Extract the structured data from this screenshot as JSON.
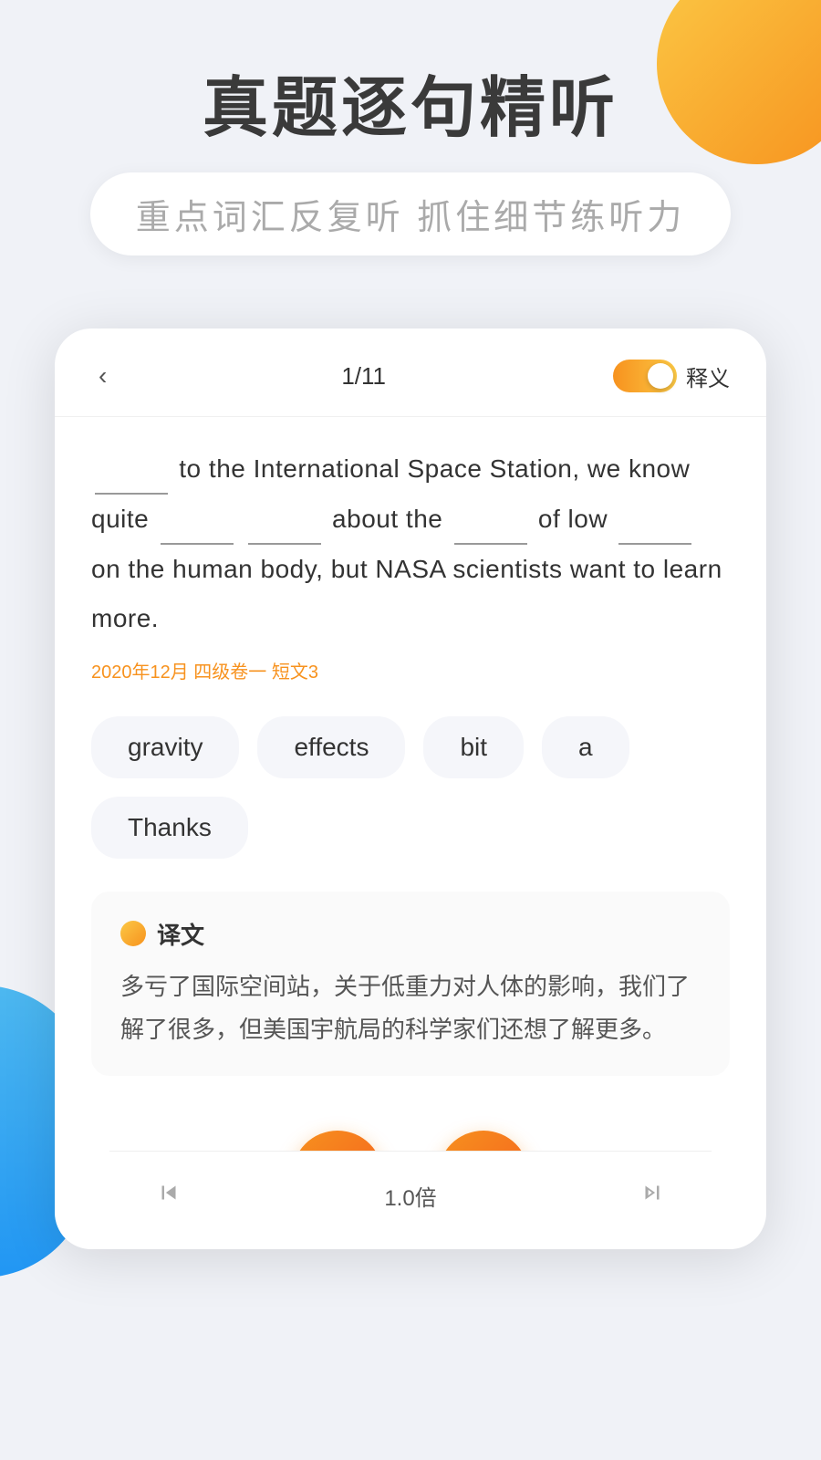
{
  "page": {
    "background_color": "#f0f2f7"
  },
  "header": {
    "main_title": "真题逐句精听",
    "subtitle": "重点词汇反复听  抓住细节练听力"
  },
  "card": {
    "back_label": "‹",
    "page_indicator": "1/11",
    "toggle_label": "释义",
    "passage_text": "________ to the International Space Station, we know quite ________ ________ about the ________ of low ________ on the human body, but NASA scientists want to learn more.",
    "source": "2020年12月 四级卷一 短文3",
    "word_options": [
      "gravity",
      "effects",
      "bit",
      "a",
      "Thanks"
    ],
    "translation": {
      "label": "译文",
      "text": "多亏了国际空间站，关于低重力对人体的影响，我们了解了很多，但美国宇航局的科学家们还想了解更多。"
    },
    "controls": {
      "pause_icon": "pause",
      "replay_icon": "replay"
    },
    "bottom_bar": {
      "prev_icon": "prev",
      "speed": "1.0倍",
      "next_icon": "next"
    }
  }
}
